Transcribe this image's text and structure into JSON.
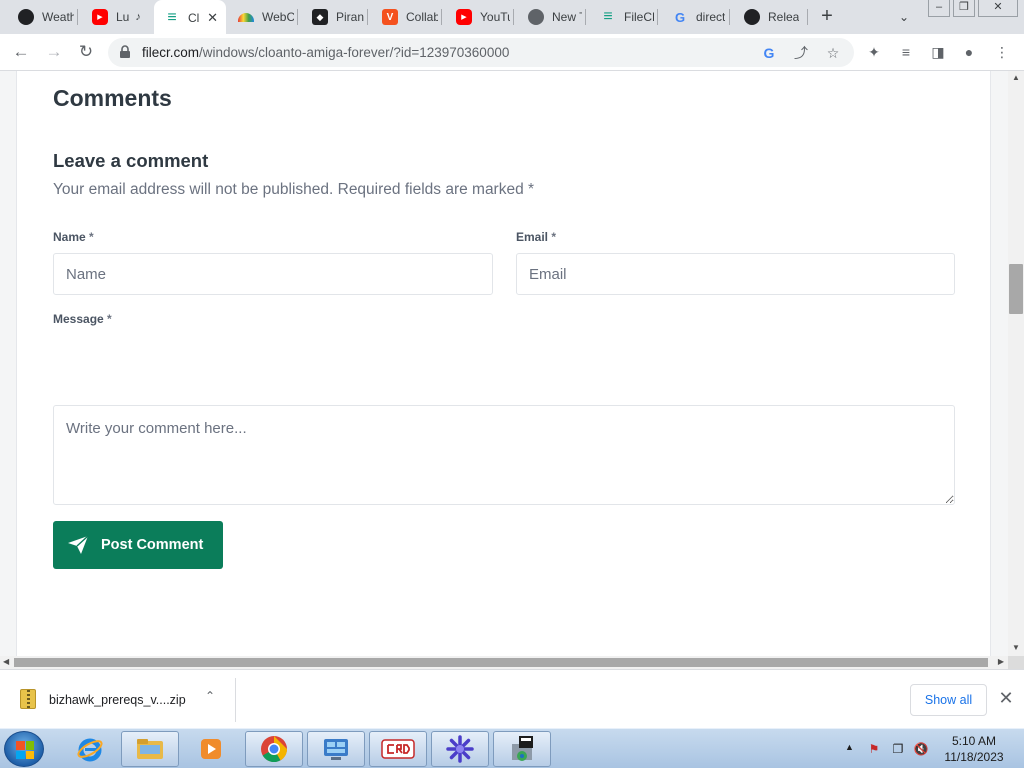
{
  "tabs": [
    {
      "label": "Weath",
      "icon": "weather-icon",
      "color": "#202124"
    },
    {
      "label": "Lu",
      "icon": "youtube-icon",
      "color": "#ff0000",
      "sound": true
    },
    {
      "label": "Cl",
      "icon": "filecr-icon",
      "color": "#16a085",
      "active": true
    },
    {
      "label": "WebC",
      "icon": "webc-icon",
      "color": "#7e57c2"
    },
    {
      "label": "Pirani",
      "icon": "piranha-icon",
      "color": "#202124"
    },
    {
      "label": "Collab",
      "icon": "collab-icon",
      "color": "#f4511e"
    },
    {
      "label": "YouTu",
      "icon": "youtube-icon",
      "color": "#ff0000"
    },
    {
      "label": "New T",
      "icon": "chrome-icon",
      "color": "#5f6368"
    },
    {
      "label": "FileCR",
      "icon": "filecr-icon",
      "color": "#16a085"
    },
    {
      "label": "direct",
      "icon": "google-icon",
      "color": "#4285f4"
    },
    {
      "label": "Relea",
      "icon": "github-icon",
      "color": "#202124"
    }
  ],
  "omnibox": {
    "url_host": "filecr.com",
    "url_path": "/windows/cloanto-amiga-forever/?id=123970360000"
  },
  "page": {
    "comments_title": "Comments",
    "leave_title": "Leave a comment",
    "notice": "Your email address will not be published. Required fields are marked *",
    "name_label": "Name",
    "email_label": "Email",
    "message_label": "Message",
    "required_mark": "*",
    "name_placeholder": "Name",
    "email_placeholder": "Email",
    "message_placeholder": "Write your comment here...",
    "post_button": "Post Comment",
    "accent_color": "#0b7d5a"
  },
  "downloads": {
    "file_name": "bizhawk_prereqs_v....zip",
    "show_all": "Show all"
  },
  "taskbar": {
    "time": "5:10 AM",
    "date": "11/18/2023"
  }
}
